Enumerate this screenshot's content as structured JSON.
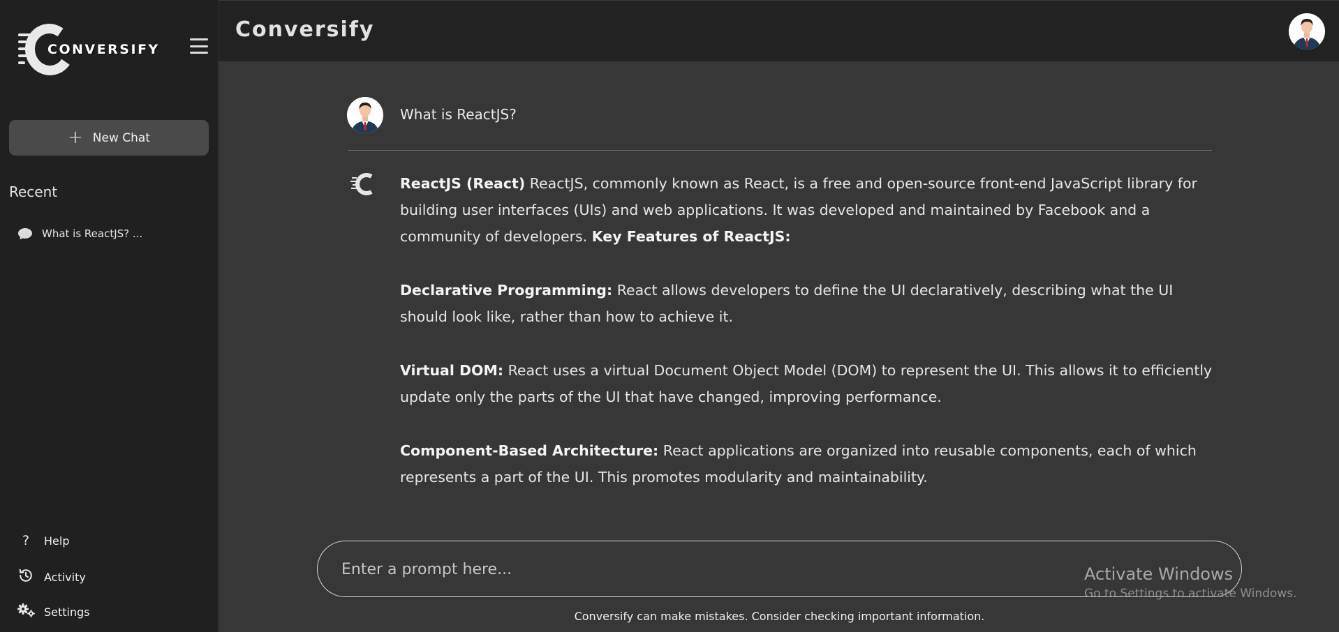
{
  "sidebar": {
    "brand": "CONVERSIFY",
    "new_chat_label": "New Chat",
    "recent_title": "Recent",
    "recent_items": [
      {
        "label": "What is ReactJS? ..."
      }
    ],
    "links": {
      "help": "Help",
      "activity": "Activity",
      "settings": "Settings"
    }
  },
  "header": {
    "title": "Conversify"
  },
  "chat": {
    "question": "What is ReactJS?",
    "answer": {
      "intro_bold": "ReactJS (React)",
      "intro_text": " ReactJS, commonly known as React, is a free and open-source front-end JavaScript library for building user interfaces (UIs) and web applications. It was developed and maintained by Facebook and a community of developers. ",
      "features_heading": "Key Features of ReactJS:",
      "features": [
        {
          "title": "Declarative Programming:",
          "text": " React allows developers to define the UI declaratively, describing what the UI should look like, rather than how to achieve it."
        },
        {
          "title": "Virtual DOM:",
          "text": " React uses a virtual Document Object Model (DOM) to represent the UI. This allows it to efficiently update only the parts of the UI that have changed, improving performance."
        },
        {
          "title": "Component-Based Architecture:",
          "text": " React applications are organized into reusable components, each of which represents a part of the UI. This promotes modularity and maintainability."
        }
      ]
    }
  },
  "prompt": {
    "placeholder": "Enter a prompt here...",
    "value": ""
  },
  "disclaimer": "Conversify can make mistakes. Consider checking important information.",
  "watermark": {
    "line1": "Activate Windows",
    "line2": "Go to Settings to activate Windows."
  },
  "icons": {
    "menu": "hamburger-menu-icon",
    "new_chat": "plus-icon",
    "recent": "chat-bubble-icon",
    "help": "question-mark-icon",
    "activity": "history-icon",
    "settings": "gears-icon"
  },
  "colors": {
    "sidebar_bg": "#202020",
    "topbar_bg": "#222222",
    "main_bg": "#373737",
    "new_chat_bg": "#4a4a4a",
    "text": "#e6e6e6"
  }
}
